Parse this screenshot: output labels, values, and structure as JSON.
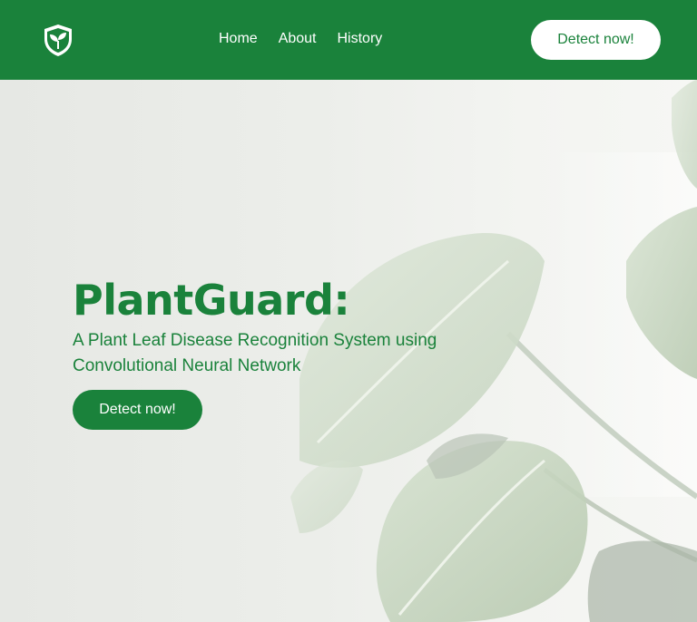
{
  "nav": {
    "logo_icon": "shield-sprout-icon",
    "links": [
      {
        "label": "Home"
      },
      {
        "label": "About"
      },
      {
        "label": "History"
      }
    ],
    "cta_label": "Detect now!"
  },
  "hero": {
    "title": "PlantGuard:",
    "subtitle": "A Plant Leaf Disease Recognition System using Convolutional Neural Network",
    "cta_label": "Detect now!",
    "background_icon": "monstera-leaves-image"
  },
  "colors": {
    "brand_green": "#1a823b",
    "background": "#eceeea",
    "white": "#ffffff"
  }
}
